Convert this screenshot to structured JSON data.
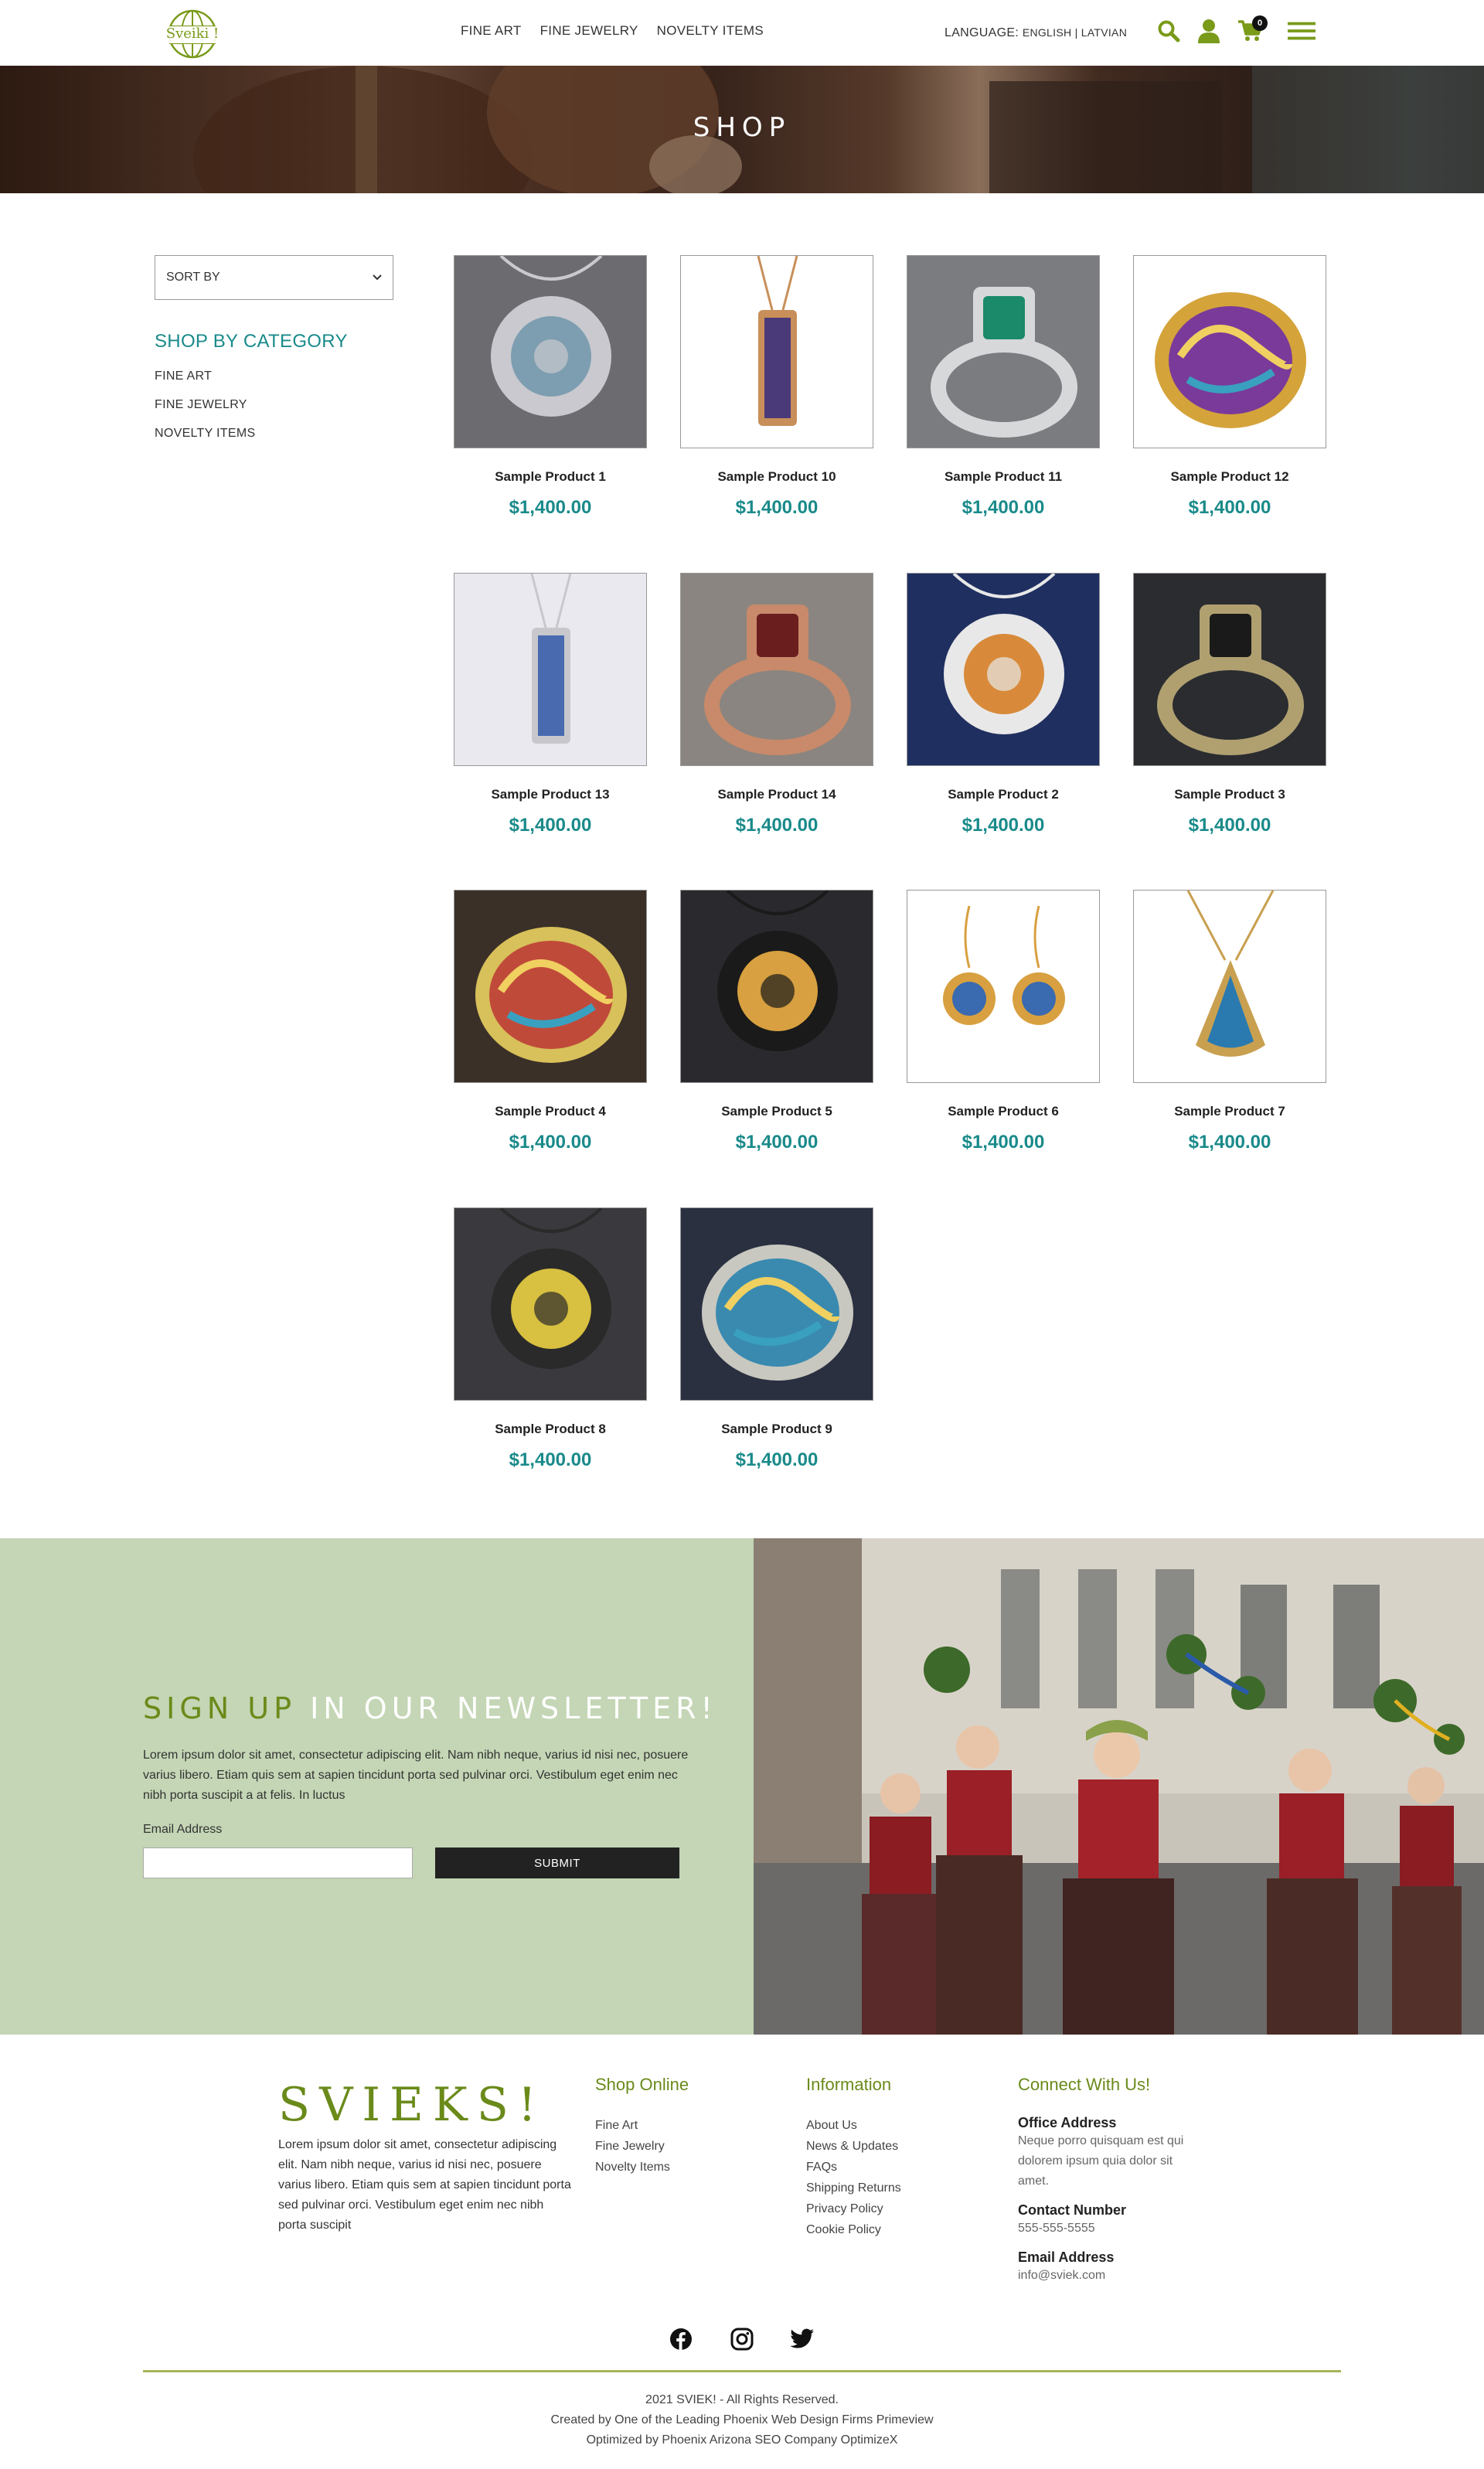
{
  "header": {
    "logo_text": "Sveiki !",
    "nav": [
      "FINE ART",
      "FINE JEWELRY",
      "NOVELTY ITEMS"
    ],
    "language_label": "LANGUAGE:",
    "language_options": "ENGLISH | LATVIAN",
    "cart_count": "0",
    "icons": [
      "search-icon",
      "user-icon",
      "cart-icon",
      "menu-icon"
    ]
  },
  "hero": {
    "title": "SHOP"
  },
  "sidebar": {
    "sort_label": "SORT BY",
    "category_title": "SHOP BY CATEGORY",
    "categories": [
      "FINE ART",
      "FINE JEWELRY",
      "NOVELTY ITEMS"
    ]
  },
  "products": [
    {
      "name": "Sample Product 1",
      "price": "$1,400.00"
    },
    {
      "name": "Sample Product 10",
      "price": "$1,400.00"
    },
    {
      "name": "Sample Product 11",
      "price": "$1,400.00"
    },
    {
      "name": "Sample Product 12",
      "price": "$1,400.00"
    },
    {
      "name": "Sample Product 13",
      "price": "$1,400.00"
    },
    {
      "name": "Sample Product 14",
      "price": "$1,400.00"
    },
    {
      "name": "Sample Product 2",
      "price": "$1,400.00"
    },
    {
      "name": "Sample Product 3",
      "price": "$1,400.00"
    },
    {
      "name": "Sample Product 4",
      "price": "$1,400.00"
    },
    {
      "name": "Sample Product 5",
      "price": "$1,400.00"
    },
    {
      "name": "Sample Product 6",
      "price": "$1,400.00"
    },
    {
      "name": "Sample Product 7",
      "price": "$1,400.00"
    },
    {
      "name": "Sample Product 8",
      "price": "$1,400.00"
    },
    {
      "name": "Sample Product 9",
      "price": "$1,400.00"
    }
  ],
  "newsletter": {
    "title_part1": "SIGN UP",
    "title_part2": " IN OUR NEWSLETTER!",
    "text": "Lorem ipsum dolor sit amet, consectetur adipiscing elit. Nam nibh neque, varius id nisi nec, posuere varius libero. Etiam quis sem at sapien tincidunt porta sed pulvinar orci. Vestibulum eget enim nec nibh porta suscipit a at felis. In luctus",
    "email_label": "Email Address",
    "email_value": "",
    "submit_label": "SUBMIT"
  },
  "footer": {
    "brand": "SVIEKS!",
    "about": "Lorem ipsum dolor sit amet, consectetur adipiscing elit. Nam nibh neque, varius id nisi nec, posuere varius libero. Etiam quis sem at sapien tincidunt porta sed pulvinar orci. Vestibulum eget enim nec nibh porta suscipit",
    "shop_title": "Shop Online",
    "shop_links": [
      "Fine Art",
      "Fine Jewelry",
      "Novelty Items"
    ],
    "info_title": "Information",
    "info_links": [
      "About Us",
      "News & Updates",
      "FAQs",
      "Shipping Returns",
      "Privacy Policy",
      "Cookie Policy"
    ],
    "connect_title": "Connect With Us!",
    "office_label": "Office Address",
    "office_value": "Neque porro quisquam est qui dolorem ipsum quia dolor sit amet.",
    "phone_label": "Contact Number",
    "phone_value": "555-555-5555",
    "email_label": "Email Address",
    "email_value": "info@sviek.com",
    "social": [
      "facebook-icon",
      "instagram-icon",
      "twitter-icon"
    ],
    "copyright": "2021 SVIEK! - All Rights Reserved.",
    "credit1": "Created by One of the Leading Phoenix Web Design Firms Primeview",
    "credit2": "Optimized by Phoenix Arizona SEO Company OptimizeX"
  },
  "colors": {
    "accent_green": "#6a8a1a",
    "teal": "#1a8a8a",
    "newsletter_bg": "#c4d6b5",
    "icon_green": "#7a9a1a"
  }
}
